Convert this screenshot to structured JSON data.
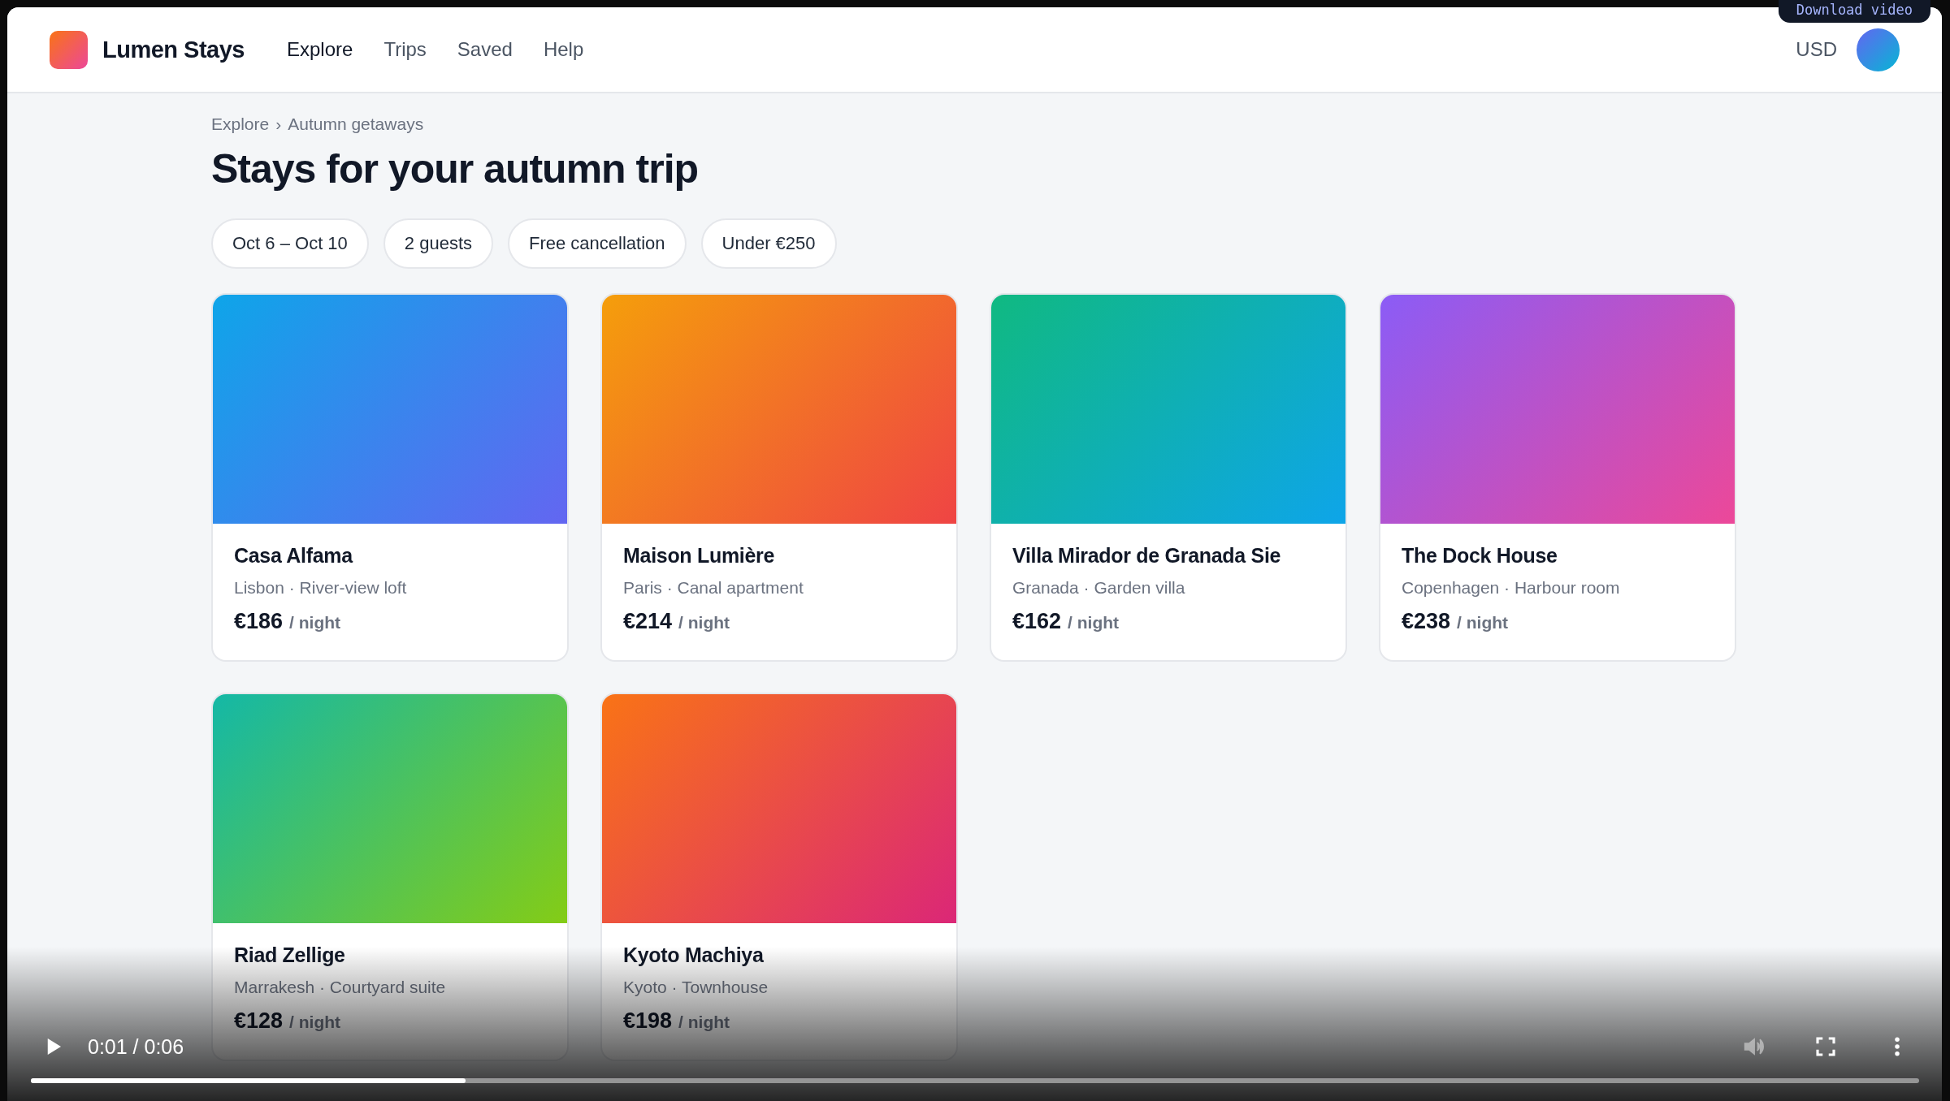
{
  "video_tooltip": "Download video",
  "brand": "Lumen Stays",
  "nav": [
    {
      "label": "Explore",
      "selected": true
    },
    {
      "label": "Trips",
      "selected": false
    },
    {
      "label": "Saved",
      "selected": false
    },
    {
      "label": "Help",
      "selected": false
    }
  ],
  "currency": "USD",
  "breadcrumb": [
    "Explore",
    "›",
    "Autumn getaways"
  ],
  "title": "Stays for your autumn trip",
  "filters": [
    "Oct 6 – Oct 10",
    "2 guests",
    "Free cancellation",
    "Under €250"
  ],
  "stays": [
    {
      "name": "Casa Alfama",
      "place": "Lisbon · River-view loft",
      "price": "€186",
      "unit": "/ night"
    },
    {
      "name": "Maison Lumière",
      "place": "Paris · Canal apartment",
      "price": "€214",
      "unit": "/ night"
    },
    {
      "name": "Villa Mirador de Granada Sie",
      "place": "Granada · Garden villa",
      "price": "€162",
      "unit": "/ night"
    },
    {
      "name": "The Dock House",
      "place": "Copenhagen · Harbour room",
      "price": "€238",
      "unit": "/ night"
    },
    {
      "name": "Riad Zellige",
      "place": "Marrakesh · Courtyard suite",
      "price": "€128",
      "unit": "/ night"
    },
    {
      "name": "Kyoto Machiya",
      "place": "Kyoto · Townhouse",
      "price": "€198",
      "unit": "/ night"
    }
  ],
  "player": {
    "time": "0:01 / 0:06",
    "level": 0.23
  }
}
